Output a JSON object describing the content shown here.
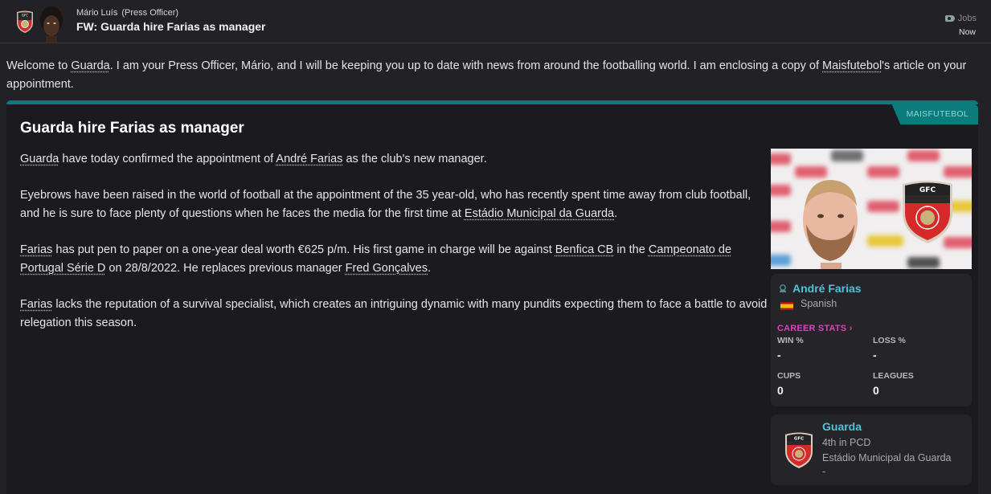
{
  "header": {
    "sender_name": "Mário Luís",
    "sender_role": "(Press Officer)",
    "subject": "FW: Guarda hire Farias as manager",
    "category_icon": "tag-icon",
    "category": "Jobs",
    "time": "Now"
  },
  "intro": {
    "t1": "Welcome to ",
    "link1": "Guarda",
    "t2": ". I am your Press Officer, Mário, and I will be keeping you up to date with news from around the footballing world. I am enclosing a copy of ",
    "link2": "Maisfutebol",
    "t3": "'s article on your appointment."
  },
  "article": {
    "source": "MAISFUTEBOL",
    "title": "Guarda hire Farias as manager",
    "p1": {
      "link1": "Guarda",
      "t1": " have today confirmed the appointment of ",
      "link2": "André Farias",
      "t2": " as the club's new manager."
    },
    "p2": {
      "t1": "Eyebrows have been raised in the world of football at the appointment of the 35 year-old, who has recently spent time away from club football, and he is sure to face plenty of questions when he faces the media for the first time at ",
      "link1": "Estádio Municipal da Guarda",
      "t2": "."
    },
    "p3": {
      "link1": "Farias",
      "t1": " has put pen to paper on a one-year deal worth €625 p/m. His first game in charge will be against ",
      "link2": "Benfica CB",
      "t2": " in the ",
      "link3": "Campeonato de Portugal Série D",
      "t3": " on 28/8/2022. He replaces previous manager ",
      "link4": "Fred Gonçalves",
      "t4": "."
    },
    "p4": {
      "link1": "Farias",
      "t1": " lacks the reputation of a survival specialist, which creates an intriguing dynamic with many pundits expecting them to face a battle to avoid relegation this season."
    }
  },
  "person": {
    "name": "André Farias",
    "nationality": "Spanish",
    "career_stats_label": "CAREER STATS ›",
    "stats": [
      {
        "label": "WIN %",
        "value": "-"
      },
      {
        "label": "LOSS %",
        "value": "-"
      },
      {
        "label": "CUPS",
        "value": "0"
      },
      {
        "label": "LEAGUES",
        "value": "0"
      }
    ]
  },
  "club": {
    "name": "Guarda",
    "position": "4th in PCD",
    "stadium": "Estádio Municipal da Guarda",
    "extra": "-",
    "badge_text": "GFC"
  },
  "colors": {
    "accent_teal": "#0c7b7b",
    "link_cyan": "#4fc3d9",
    "career_magenta": "#e040b8"
  }
}
